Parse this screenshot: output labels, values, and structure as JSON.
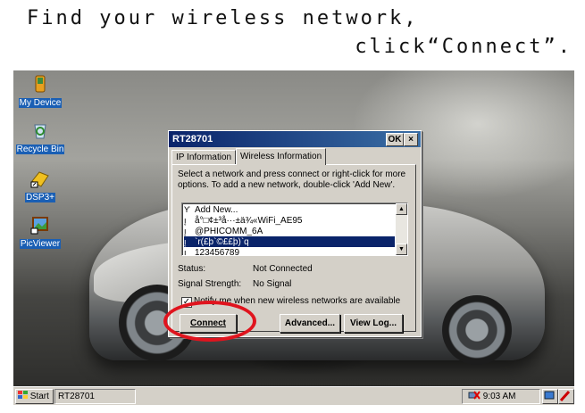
{
  "caption": {
    "line1": "Find your wireless network,",
    "line2": "click“Connect”."
  },
  "desktop": {
    "icons": [
      {
        "label": "My Device",
        "icon": "my-device-icon"
      },
      {
        "label": "Recycle Bin",
        "icon": "recycle-bin-icon"
      },
      {
        "label": "DSP3+",
        "icon": "dsp3-shortcut-icon"
      },
      {
        "label": "PicViewer",
        "icon": "picviewer-icon"
      }
    ]
  },
  "dialog": {
    "title": "RT28701",
    "ok_label": "OK",
    "close_label": "×",
    "tabs": [
      {
        "label": "IP Information",
        "active": false
      },
      {
        "label": "Wireless Information",
        "active": true
      }
    ],
    "instruction": "Select a network and press connect or right-click for more options.  To add a new network, double-click 'Add New'.",
    "networks": [
      {
        "name": "Add New...",
        "icon": "antenna-icon",
        "selected": false
      },
      {
        "name": "å°□¢±³å···±ä¾«WiFi_AE95",
        "icon": "signal-icon",
        "selected": false
      },
      {
        "name": "@PHICOMM_6A",
        "icon": "signal-icon",
        "selected": false
      },
      {
        "name": "`r(£þ`©££þ)`q",
        "icon": "signal-icon",
        "selected": true
      },
      {
        "name": "123456789",
        "icon": "signal-icon",
        "selected": false
      }
    ],
    "status_label": "Status:",
    "status_value": "Not Connected",
    "signal_label": "Signal Strength:",
    "signal_value": "No Signal",
    "notify_label": "Notify me when new wireless networks are available",
    "notify_checked": true,
    "connect_label": "Connect",
    "advanced_label": "Advanced...",
    "viewlog_label": "View Log..."
  },
  "taskbar": {
    "start_label": "Start",
    "task_label": "RT28701",
    "time": "9:03 AM"
  },
  "colors": {
    "title_bar": "#0a246a",
    "selection": "#0a246a",
    "highlight_oval": "#e0141e",
    "window_face": "#d4d0c8"
  }
}
